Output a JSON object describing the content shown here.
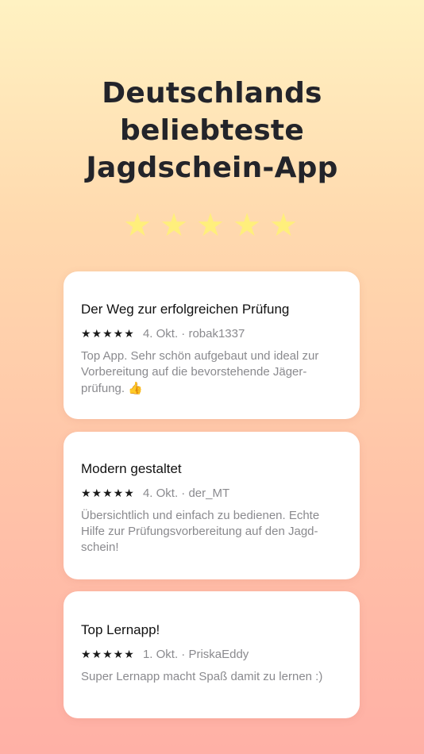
{
  "headline": {
    "line1": "Deutschlands",
    "line2": "beliebteste",
    "line3": "Jagdschein-App"
  },
  "hero_stars": [
    "★",
    "★",
    "★",
    "★",
    "★"
  ],
  "reviews": [
    {
      "title": "Der Weg zur erfolgreichen Prüfung",
      "stars": "★★★★★",
      "meta": "4. Okt. · robak1337",
      "lines": [
        "Top App. Sehr schön aufgebaut und ideal zur",
        "Vorbereitung auf die bevorstehende Jäger-",
        "prüfung."
      ],
      "emoji": "👍"
    },
    {
      "title": "Modern gestaltet",
      "stars": "★★★★★",
      "meta": "4. Okt. · der_MT",
      "lines": [
        "Übersichtlich und einfach zu bedienen. Echte",
        "Hilfe zur Prüfungsvorbereitung auf den Jagd-",
        "schein!"
      ]
    },
    {
      "title": "Top Lernapp!",
      "stars": "★★★★★",
      "meta": "1. Okt. · PriskaEddy",
      "lines": [
        "Super Lernapp macht Spaß damit zu lernen :)"
      ]
    }
  ]
}
